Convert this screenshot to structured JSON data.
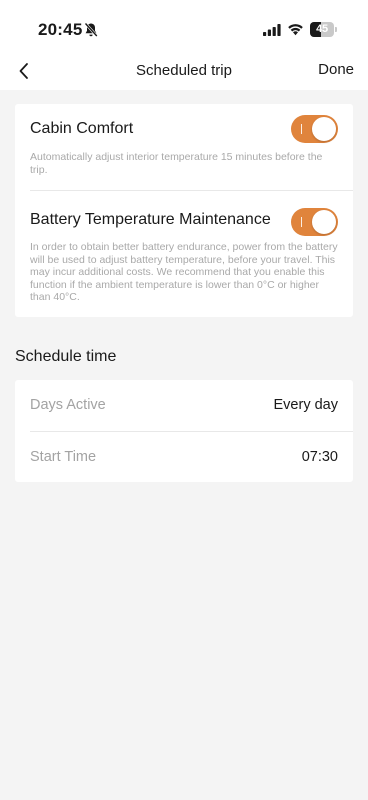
{
  "status_bar": {
    "time": "20:45",
    "battery_level": "45",
    "battery_fraction": 0.45,
    "icons": [
      "bell-muted-icon",
      "signal-icon",
      "wifi-icon",
      "battery-icon"
    ]
  },
  "nav": {
    "title": "Scheduled trip",
    "done_label": "Done",
    "back_icon": "chevron-left-icon"
  },
  "settings": {
    "cabin_comfort": {
      "title": "Cabin Comfort",
      "description": "Automatically adjust interior temperature 15 minutes before the trip.",
      "enabled": true
    },
    "battery_temp": {
      "title": "Battery Temperature Maintenance",
      "description": "In order to obtain better battery endurance, power from the battery will be used to adjust battery temperature, before your travel. This may incur additional costs. We recommend that you enable this function if the ambient temperature is lower than 0°C or higher than 40°C.",
      "enabled": true
    }
  },
  "schedule": {
    "heading": "Schedule time",
    "rows": [
      {
        "label": "Days Active",
        "value": "Every day"
      },
      {
        "label": "Start Time",
        "value": "07:30"
      }
    ]
  },
  "colors": {
    "accent": "#e0843c",
    "background": "#f4f4f4",
    "card": "#ffffff",
    "muted_text": "#a9a9a9"
  }
}
